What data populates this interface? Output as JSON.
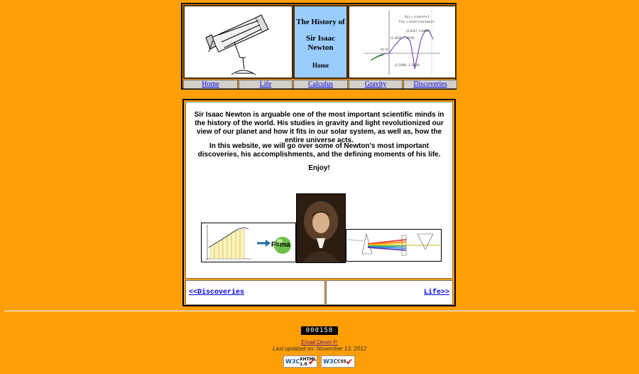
{
  "header": {
    "title_line1": "The History of",
    "title_line2": "Sir Isaac Newton",
    "title_line3": "Home",
    "graph_labels": [
      "(1.3052, 2.3076)",
      "(2.0127, 3.0691)",
      "(0, 0)",
      "(2.1949, -1.1820)"
    ],
    "nav": [
      "Home",
      "Life",
      "Calculus",
      "Gravity",
      "Discoveries"
    ]
  },
  "main": {
    "paragraph1": "Sir Isaac Newton is arguable one of the most important scientific minds in the history of the world. His studies in gravity and light revolutionized our view of our planet and how it fits in our solar system, as well as, how the entire universe acts.",
    "paragraph2": "In this website, we will go over some of Newton's most important discoveries, his accomplishments, and the defining moments of his life.",
    "paragraph3": "Enjoy!",
    "formula": "F=ma",
    "prev_link": "<<Discoveries",
    "next_link": "Life>>"
  },
  "footer": {
    "counter": "000158",
    "email": "Email Devin P.",
    "updated": "Last updated on: November 13, 2012",
    "badge_xhtml": {
      "logo": "W3C",
      "kind": "XHTML 1.0"
    },
    "badge_css": {
      "logo": "W3C",
      "kind": "CSS"
    }
  },
  "colors": {
    "background": "#ff9e05",
    "title_cell": "#99ccff",
    "link": "#0000ee"
  }
}
